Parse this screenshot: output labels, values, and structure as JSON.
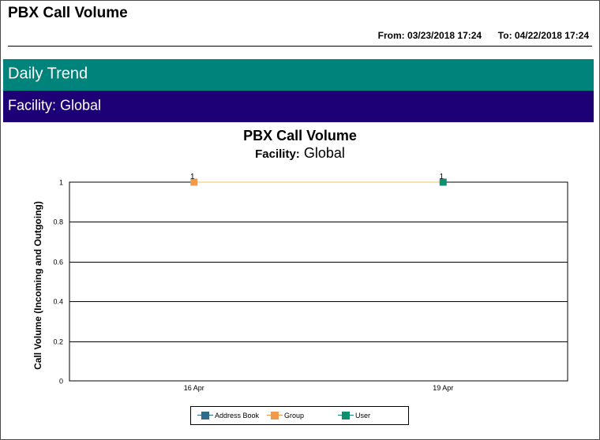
{
  "report": {
    "title": "PBX Call Volume",
    "from_label": "From:",
    "from_value": "03/23/2018 17:24",
    "to_label": "To:",
    "to_value": "04/22/2018 17:24"
  },
  "bands": {
    "trend": "Daily Trend",
    "facility": "Facility: Global"
  },
  "chart_data": {
    "type": "line",
    "title": "PBX Call Volume",
    "subtitle_label": "Facility:",
    "subtitle_value": "Global",
    "xlabel": "",
    "ylabel": "Call Volume (Incoming and Outgoing)",
    "categories": [
      "16 Apr",
      "19 Apr"
    ],
    "ylim": [
      0,
      1
    ],
    "yticks": [
      "0",
      "0.2",
      "0.4",
      "0.6",
      "0.8",
      "1"
    ],
    "grid": true,
    "legend_position": "bottom",
    "series": [
      {
        "name": "Address Book",
        "color": "#2e6b8a",
        "marker": "square",
        "values": [
          null,
          null
        ],
        "labels": [
          "",
          ""
        ]
      },
      {
        "name": "Group",
        "color": "#f29a4a",
        "marker": "square",
        "values": [
          1,
          null
        ],
        "labels": [
          "1",
          ""
        ]
      },
      {
        "name": "User",
        "color": "#0f8f6f",
        "marker": "square",
        "values": [
          null,
          1
        ],
        "labels": [
          "",
          "1"
        ]
      }
    ],
    "connector": {
      "from_series": "Group",
      "to_series": "User",
      "color": "#f0c060"
    }
  }
}
